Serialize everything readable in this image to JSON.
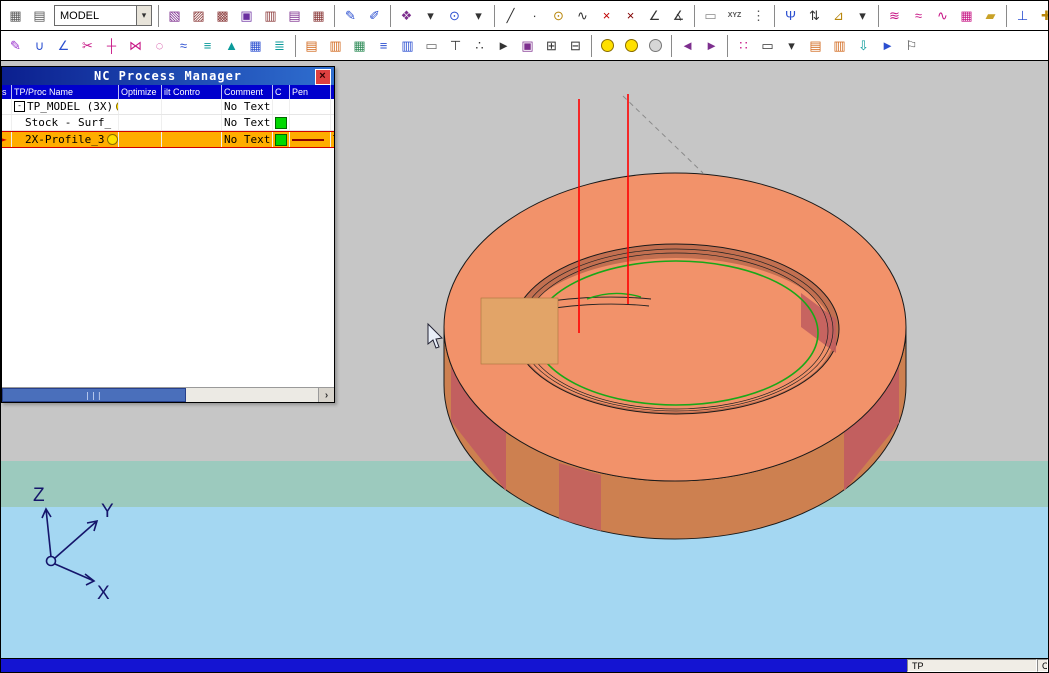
{
  "colors": {
    "selection_orange": "#ffad00",
    "band_teal": "#9ccabe",
    "band_blue": "#a4d7f2",
    "torus_top": "#f2926a",
    "torus_side": "#cd8050",
    "torus_inner": "#c26f50",
    "patch_red": "#c25f5f",
    "toolpath_red": "#ff0000",
    "toolpath_green": "#18a818",
    "header_blue": "#0000cd",
    "title_gradient_start": "#0b1f8f",
    "title_gradient_end": "#2f6fd0",
    "status_blue": "#1414d2"
  },
  "toolbar": {
    "view_combo": "MODEL",
    "row1": [
      {
        "name": "select-grid-icon",
        "g": "▦",
        "c": "#5a5a5a"
      },
      {
        "name": "layer-icon",
        "g": "▤",
        "c": "#5a5a5a"
      },
      {
        "combo": true
      },
      {
        "sep": true
      },
      {
        "name": "shaded-view-icon",
        "g": "▧",
        "c": "#7d2f8e"
      },
      {
        "name": "wireframe-view-icon",
        "g": "▨",
        "c": "#8b3a3a"
      },
      {
        "name": "hidden-line-view-icon",
        "g": "▩",
        "c": "#8b3a3a"
      },
      {
        "name": "solid-box-icon",
        "g": "▣",
        "c": "#6b2fa0"
      },
      {
        "name": "box-fit-icon",
        "g": "▥",
        "c": "#8b3a3a"
      },
      {
        "name": "box-top-icon",
        "g": "▤",
        "c": "#7d2f8e"
      },
      {
        "name": "box-iso-icon",
        "g": "▦",
        "c": "#8b3a3a"
      },
      {
        "sep": true
      },
      {
        "name": "sketch-icon",
        "g": "✎",
        "c": "#2b4fd0"
      },
      {
        "name": "annotate-icon",
        "g": "✐",
        "c": "#2b4fd0"
      },
      {
        "sep": true
      },
      {
        "name": "entity-select-icon",
        "g": "❖",
        "c": "#7d2f8e"
      },
      {
        "name": "entity-dropdown-icon",
        "g": "▾",
        "c": "#333333"
      },
      {
        "name": "zoom-icon",
        "g": "⊙",
        "c": "#2b4fd0"
      },
      {
        "name": "zoom-dropdown-icon",
        "g": "▾",
        "c": "#333333"
      },
      {
        "sep": true
      },
      {
        "name": "line-tool-icon",
        "g": "╱",
        "c": "#333333"
      },
      {
        "name": "point-tool-icon",
        "g": "∙",
        "c": "#333333"
      },
      {
        "name": "circle-tool-icon",
        "g": "⊙",
        "c": "#b8860b"
      },
      {
        "name": "curve-tool-icon",
        "g": "∿",
        "c": "#333333"
      },
      {
        "name": "delete-tool-icon",
        "g": "×",
        "c": "#c00000"
      },
      {
        "name": "delete-duplicates-icon",
        "g": "×",
        "c": "#800000"
      },
      {
        "name": "measure-angle-icon",
        "g": "∠",
        "c": "#333333"
      },
      {
        "name": "analyze-icon",
        "g": "∡",
        "c": "#333333"
      },
      {
        "sep": true
      },
      {
        "name": "screen-blank-icon",
        "g": "▭",
        "c": "#8a8a8a"
      },
      {
        "name": "xyz-icon",
        "g": "XYZ",
        "c": "#555555",
        "small": true
      },
      {
        "name": "stats-icon",
        "g": "⋮",
        "c": "#555555"
      },
      {
        "sep": true
      },
      {
        "name": "levels-icon",
        "g": "Ψ",
        "c": "#2b4fd0"
      },
      {
        "name": "flip-icon",
        "g": "⇅",
        "c": "#333333"
      },
      {
        "name": "cplane-icon",
        "g": "⊿",
        "c": "#b8860b"
      },
      {
        "name": "cplane-dropdown-icon",
        "g": "▾",
        "c": "#333333"
      },
      {
        "sep": true
      },
      {
        "name": "surface-icon",
        "g": "≋",
        "c": "#c71585"
      },
      {
        "name": "surface-trim-icon",
        "g": "≈",
        "c": "#c71585"
      },
      {
        "name": "surface-blend-icon",
        "g": "∿",
        "c": "#c71585"
      },
      {
        "name": "mesh-icon",
        "g": "▦",
        "c": "#c71585"
      },
      {
        "name": "sheet-icon",
        "g": "▰",
        "c": "#c9a227"
      },
      {
        "sep": true
      },
      {
        "name": "gnomon-icon",
        "g": "⊥",
        "c": "#2b4fd0"
      },
      {
        "name": "axes-icon",
        "g": "✚",
        "c": "#b8860b"
      },
      {
        "name": "rotate-view-icon",
        "g": "↻",
        "c": "#2b4fd0"
      },
      {
        "name": "world-coords-icon",
        "g": "◉",
        "c": "#b8860b"
      }
    ],
    "row2": [
      {
        "name": "pencil-curve-icon",
        "g": "✎",
        "c": "#9932cc"
      },
      {
        "name": "fillet-icon",
        "g": "∪",
        "c": "#2b4fd0"
      },
      {
        "name": "chamfer-icon",
        "g": "∠",
        "c": "#2b4fd0"
      },
      {
        "name": "trim-icon",
        "g": "✂",
        "c": "#c71585"
      },
      {
        "name": "divide-icon",
        "g": "┼",
        "c": "#c71585"
      },
      {
        "name": "join-icon",
        "g": "⋈",
        "c": "#c71585"
      },
      {
        "name": "close-curve-icon",
        "g": "◌",
        "c": "#c71585"
      },
      {
        "name": "zigzag-icon",
        "g": "≈",
        "c": "#2b4fd0"
      },
      {
        "name": "offset-icon",
        "g": "≡",
        "c": "#0a9a9a"
      },
      {
        "name": "project-icon",
        "g": "▲",
        "c": "#0a9a9a"
      },
      {
        "name": "calculator-icon",
        "g": "▦",
        "c": "#2b4fd0"
      },
      {
        "name": "report-icon",
        "g": "≣",
        "c": "#0a9a9a"
      },
      {
        "sep": true
      },
      {
        "name": "toolpath-book-icon",
        "g": "▤",
        "c": "#d2691e"
      },
      {
        "name": "operations-book-icon",
        "g": "▥",
        "c": "#d2691e"
      },
      {
        "name": "table-icon",
        "g": "▦",
        "c": "#2e8b57"
      },
      {
        "name": "list-icon",
        "g": "≡",
        "c": "#2b4fd0"
      },
      {
        "name": "properties-panel-icon",
        "g": "▥",
        "c": "#2b4fd0"
      },
      {
        "name": "comment-bubble-icon",
        "g": "▭",
        "c": "#6a6a6a"
      },
      {
        "name": "tool-table-icon",
        "g": "⊤",
        "c": "#333333"
      },
      {
        "name": "pick-point-icon",
        "g": "∴",
        "c": "#333333"
      },
      {
        "name": "cursor-select-icon",
        "g": "►",
        "c": "#333333"
      },
      {
        "name": "wcs-cube-icon",
        "g": "▣",
        "c": "#7d2f8e"
      },
      {
        "name": "grid-plus-icon",
        "g": "⊞",
        "c": "#333333"
      },
      {
        "name": "grid-minus-icon",
        "g": "⊟",
        "c": "#333333"
      },
      {
        "sep": true
      },
      {
        "bulb": "on",
        "name": "shade-on-bulb-icon"
      },
      {
        "bulb": "on",
        "name": "highlight-bulb-icon"
      },
      {
        "bulb": "off",
        "name": "shade-off-bulb-icon"
      },
      {
        "sep": true
      },
      {
        "name": "prev-arrow-icon",
        "g": "◄",
        "c": "#7d2f8e"
      },
      {
        "name": "next-arrow-icon",
        "g": "►",
        "c": "#7d2f8e"
      },
      {
        "sep": true
      },
      {
        "name": "palette-icon",
        "g": "∷",
        "c": "#c71585"
      },
      {
        "name": "measure-ruler-icon",
        "g": "▭",
        "c": "#333333"
      },
      {
        "name": "ruler-dropdown-icon",
        "g": "▾",
        "c": "#333333"
      },
      {
        "name": "copy-icon",
        "g": "▤",
        "c": "#d2691e"
      },
      {
        "name": "paste-icon",
        "g": "▥",
        "c": "#d2691e"
      },
      {
        "name": "pin-icon",
        "g": "⇩",
        "c": "#0a9a9a"
      },
      {
        "name": "pointer-icon",
        "g": "►",
        "c": "#2b4fd0"
      },
      {
        "name": "flag-icon",
        "g": "⚐",
        "c": "#333333"
      }
    ]
  },
  "panel": {
    "title": "NC Process Manager",
    "close_glyph": "×",
    "header": {
      "c0": "s",
      "name": "TP/Proc Name",
      "optimize": "Optimize",
      "tilt": "ilt Contro",
      "comment": "Comment",
      "c": "C",
      "pen": "Pen",
      "rest": ""
    },
    "rows": [
      {
        "expand": "-",
        "name": "TP_MODEL (3X)",
        "comment": "No Text"
      },
      {
        "name": "Stock - Surf_",
        "comment": "No Text"
      },
      {
        "marker": "►",
        "name": "2X-Profile_3",
        "comment": "No Text",
        "pen_label": "T"
      }
    ],
    "scroll": {
      "grip": "|||",
      "arrow": "›"
    }
  },
  "viewport": {
    "axis": {
      "x": "X",
      "y": "Y",
      "z": "Z"
    }
  },
  "statusbar": {
    "tp": "TP",
    "c": "C"
  }
}
